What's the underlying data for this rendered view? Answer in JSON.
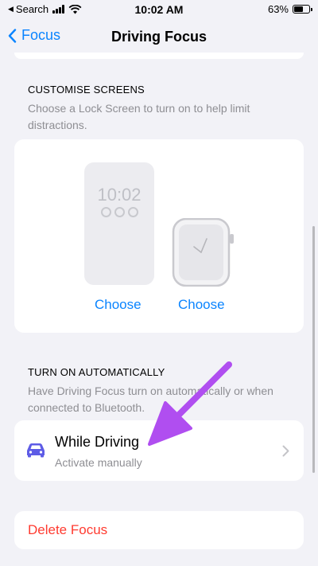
{
  "status_bar": {
    "carrier": "Search",
    "time": "10:02 AM",
    "battery": "63%",
    "battery_level": 0.63
  },
  "nav": {
    "back_label": "Focus",
    "title": "Driving Focus"
  },
  "customise_screens": {
    "header": "CUSTOMISE SCREENS",
    "description": "Choose a Lock Screen to turn on to help limit distractions.",
    "lock_screen_time": "10:02",
    "choose_phone": "Choose",
    "choose_watch": "Choose"
  },
  "turn_on": {
    "header": "TURN ON AUTOMATICALLY",
    "description": "Have Driving Focus turn on automatically or when connected to Bluetooth.",
    "row_title": "While Driving",
    "row_subtitle": "Activate manually"
  },
  "delete_label": "Delete Focus",
  "colors": {
    "accent": "#0a84ff",
    "destructive": "#ff3b30",
    "car_icon": "#5e5ce6",
    "annotation_arrow": "#b04ef0"
  }
}
